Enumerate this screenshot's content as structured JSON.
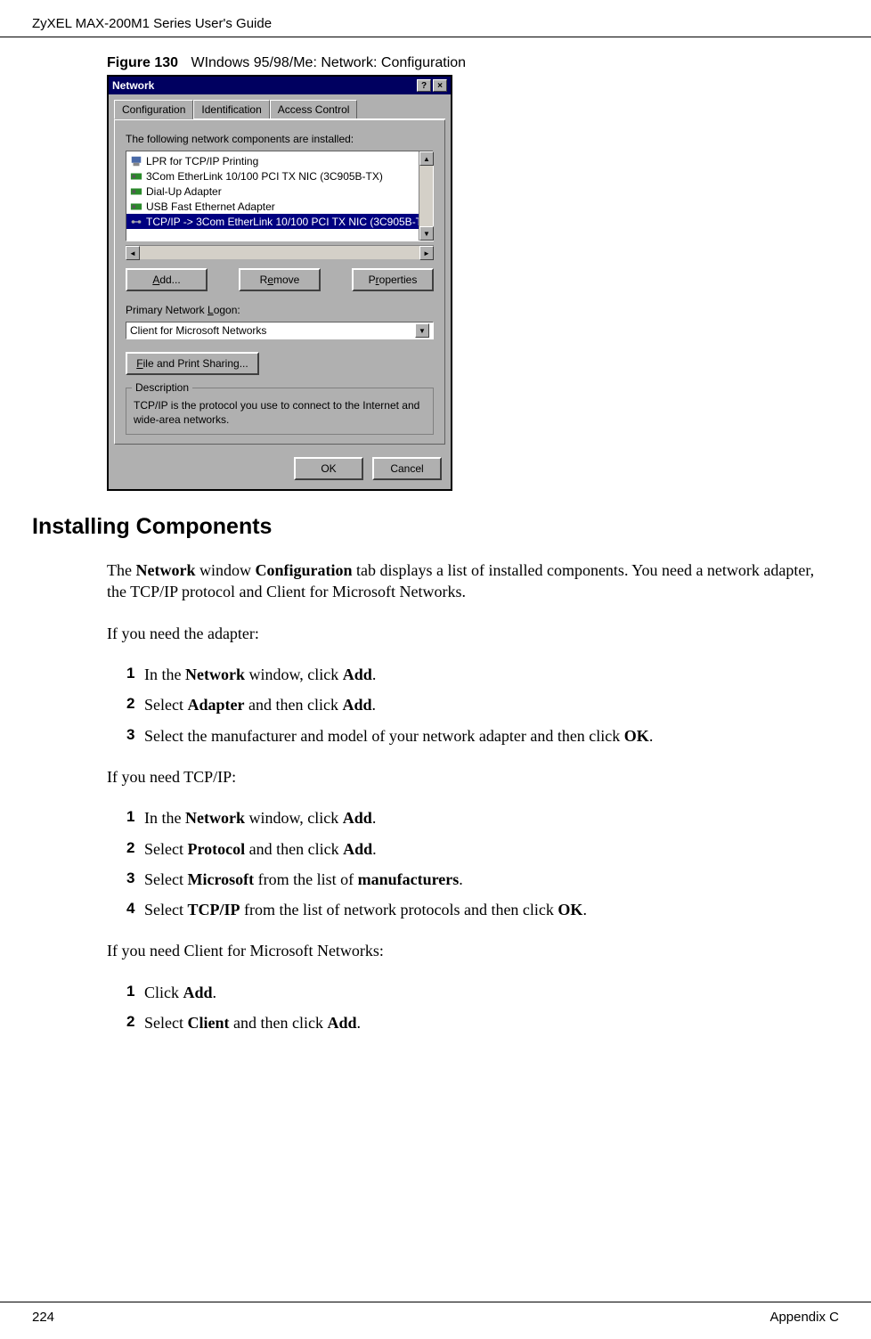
{
  "header": {
    "title": "ZyXEL MAX-200M1 Series User's Guide"
  },
  "figure": {
    "label": "Figure 130",
    "caption": "WIndows 95/98/Me: Network: Configuration"
  },
  "dialog": {
    "title": "Network",
    "help_icon": "?",
    "close_icon": "×",
    "tabs": [
      "Configuration",
      "Identification",
      "Access Control"
    ],
    "active_tab": "Configuration",
    "components_label": "The following network components are installed:",
    "components": [
      {
        "icon": "printer",
        "text": "LPR for TCP/IP Printing"
      },
      {
        "icon": "nic",
        "text": "3Com EtherLink 10/100 PCI TX NIC (3C905B-TX)"
      },
      {
        "icon": "nic",
        "text": "Dial-Up Adapter"
      },
      {
        "icon": "nic",
        "text": "USB Fast Ethernet Adapter"
      },
      {
        "icon": "protocol",
        "text": "TCP/IP -> 3Com EtherLink 10/100 PCI TX NIC (3C905B-T",
        "selected": true
      }
    ],
    "buttons": {
      "add": "Add...",
      "remove": "Remove",
      "properties": "Properties"
    },
    "logon_label": "Primary Network Logon:",
    "logon_value": "Client for Microsoft Networks",
    "fps_button": "File and Print Sharing...",
    "description_label": "Description",
    "description_text": "TCP/IP is the protocol you use to connect to the Internet and wide-area networks.",
    "ok": "OK",
    "cancel": "Cancel"
  },
  "section": {
    "heading": "Installing Components",
    "intro_pre": "The ",
    "intro_b1": "Network",
    "intro_mid1": " window ",
    "intro_b2": "Configuration",
    "intro_post": " tab displays a list of installed components. You need a network adapter, the TCP/IP protocol and Client for Microsoft Networks.",
    "need_adapter": "If you need the adapter:",
    "adapter_steps": [
      {
        "pre": "In the ",
        "b1": "Network",
        "mid1": " window, click ",
        "b2": "Add",
        "post": "."
      },
      {
        "pre": "Select ",
        "b1": "Adapter",
        "mid1": " and then click ",
        "b2": "Add",
        "post": "."
      },
      {
        "pre": "Select the manufacturer and model of your network adapter and then click ",
        "b1": "OK",
        "post": "."
      }
    ],
    "need_tcpip": "If you need TCP/IP:",
    "tcpip_steps": [
      {
        "pre": "In the ",
        "b1": "Network",
        "mid1": " window, click ",
        "b2": "Add",
        "post": "."
      },
      {
        "pre": "Select ",
        "b1": "Protocol",
        "mid1": " and then click ",
        "b2": "Add",
        "post": "."
      },
      {
        "pre": "Select ",
        "b1": "Microsoft",
        "mid1": " from the list of ",
        "b2": "manufacturers",
        "post": "."
      },
      {
        "pre": "Select ",
        "b1": "TCP/IP",
        "mid1": " from the list of network protocols and then click ",
        "b2": "OK",
        "post": "."
      }
    ],
    "need_client": "If you need Client for Microsoft Networks:",
    "client_steps": [
      {
        "pre": "Click ",
        "b1": "Add",
        "post": "."
      },
      {
        "pre": "Select ",
        "b1": "Client",
        "mid1": " and then click ",
        "b2": "Add",
        "post": "."
      }
    ]
  },
  "footer": {
    "page": "224",
    "section": "Appendix C"
  }
}
